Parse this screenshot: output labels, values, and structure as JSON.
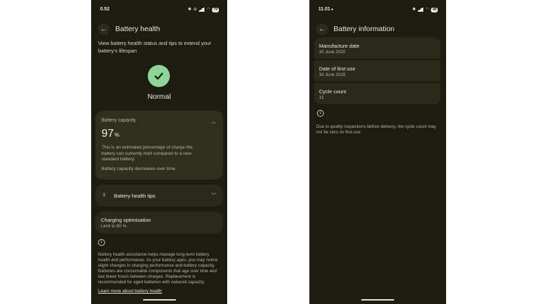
{
  "left_screen": {
    "status_bar": {
      "time": "0.52",
      "battery_level": "79"
    },
    "title": "Battery health",
    "intro": "View battery health status and tips to extend your battery's lifespan",
    "status_label": "Normal",
    "capacity": {
      "title": "Battery capacity",
      "value": "97",
      "unit": "%",
      "description": "This is an estimated percentage of charge the battery can currently hold compared to a new standard battery.",
      "note": "Battery capacity decreases over time."
    },
    "tips_label": "Battery health tips",
    "charging": {
      "title": "Charging optimisation",
      "subtitle": "Limit to 80 %"
    },
    "footer_text": "Battery health assistance helps manage long-term battery health and performance. As your battery ages, you may notice slight changes in charging performance and battery capacity. Batteries are consumable components that age over time and last fewer hours between charges. Replacement is recommended for aged batteries with reduced capacity.",
    "footer_link": "Learn more about battery health"
  },
  "right_screen": {
    "status_bar": {
      "time": "11.01",
      "battery_level": "48"
    },
    "title": "Battery information",
    "items": [
      {
        "title": "Manufacture date",
        "value": "30 June 2025"
      },
      {
        "title": "Date of first use",
        "value": "30 June 2025"
      },
      {
        "title": "Cycle count",
        "value": "31"
      }
    ],
    "note": "Due to quality inspections before delivery, the cycle count may not be zero on first use"
  },
  "colors": {
    "background": "#1c1c10",
    "card": "#2a2a1a",
    "accent_green": "#8fd59a",
    "text_primary": "#efece0",
    "text_secondary": "#b9b6a3"
  },
  "icons": [
    "back-arrow-icon",
    "checkmark-icon",
    "chevron-up-icon",
    "chevron-down-icon",
    "lightbulb-sparkle-icon",
    "info-icon",
    "wifi-icon",
    "signal-icon",
    "bluetooth-icon",
    "battery-icon"
  ]
}
